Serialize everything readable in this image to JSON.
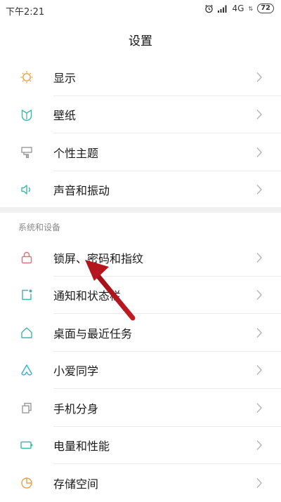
{
  "status": {
    "time": "下午2:21",
    "network": "4G",
    "battery": "72"
  },
  "header": {
    "title": "设置"
  },
  "group1": [
    {
      "label": "显示",
      "icon": "brightness-icon"
    },
    {
      "label": "壁纸",
      "icon": "wallpaper-icon"
    },
    {
      "label": "个性主题",
      "icon": "theme-icon"
    },
    {
      "label": "声音和振动",
      "icon": "sound-icon"
    }
  ],
  "section2": {
    "header": "系统和设备",
    "items": [
      {
        "label": "锁屏、密码和指纹",
        "icon": "lock-icon"
      },
      {
        "label": "通知和状态栏",
        "icon": "notification-icon"
      },
      {
        "label": "桌面与最近任务",
        "icon": "home-icon"
      },
      {
        "label": "小爱同学",
        "icon": "xiaoai-icon"
      },
      {
        "label": "手机分身",
        "icon": "dual-space-icon"
      },
      {
        "label": "电量和性能",
        "icon": "battery-icon"
      },
      {
        "label": "存储空间",
        "icon": "storage-icon"
      }
    ]
  },
  "colors": {
    "orange": "#e8a04a",
    "teal": "#3fb6a8",
    "gray": "#9a9a9a",
    "red": "#d9727a",
    "arrow": "#b5161d"
  }
}
